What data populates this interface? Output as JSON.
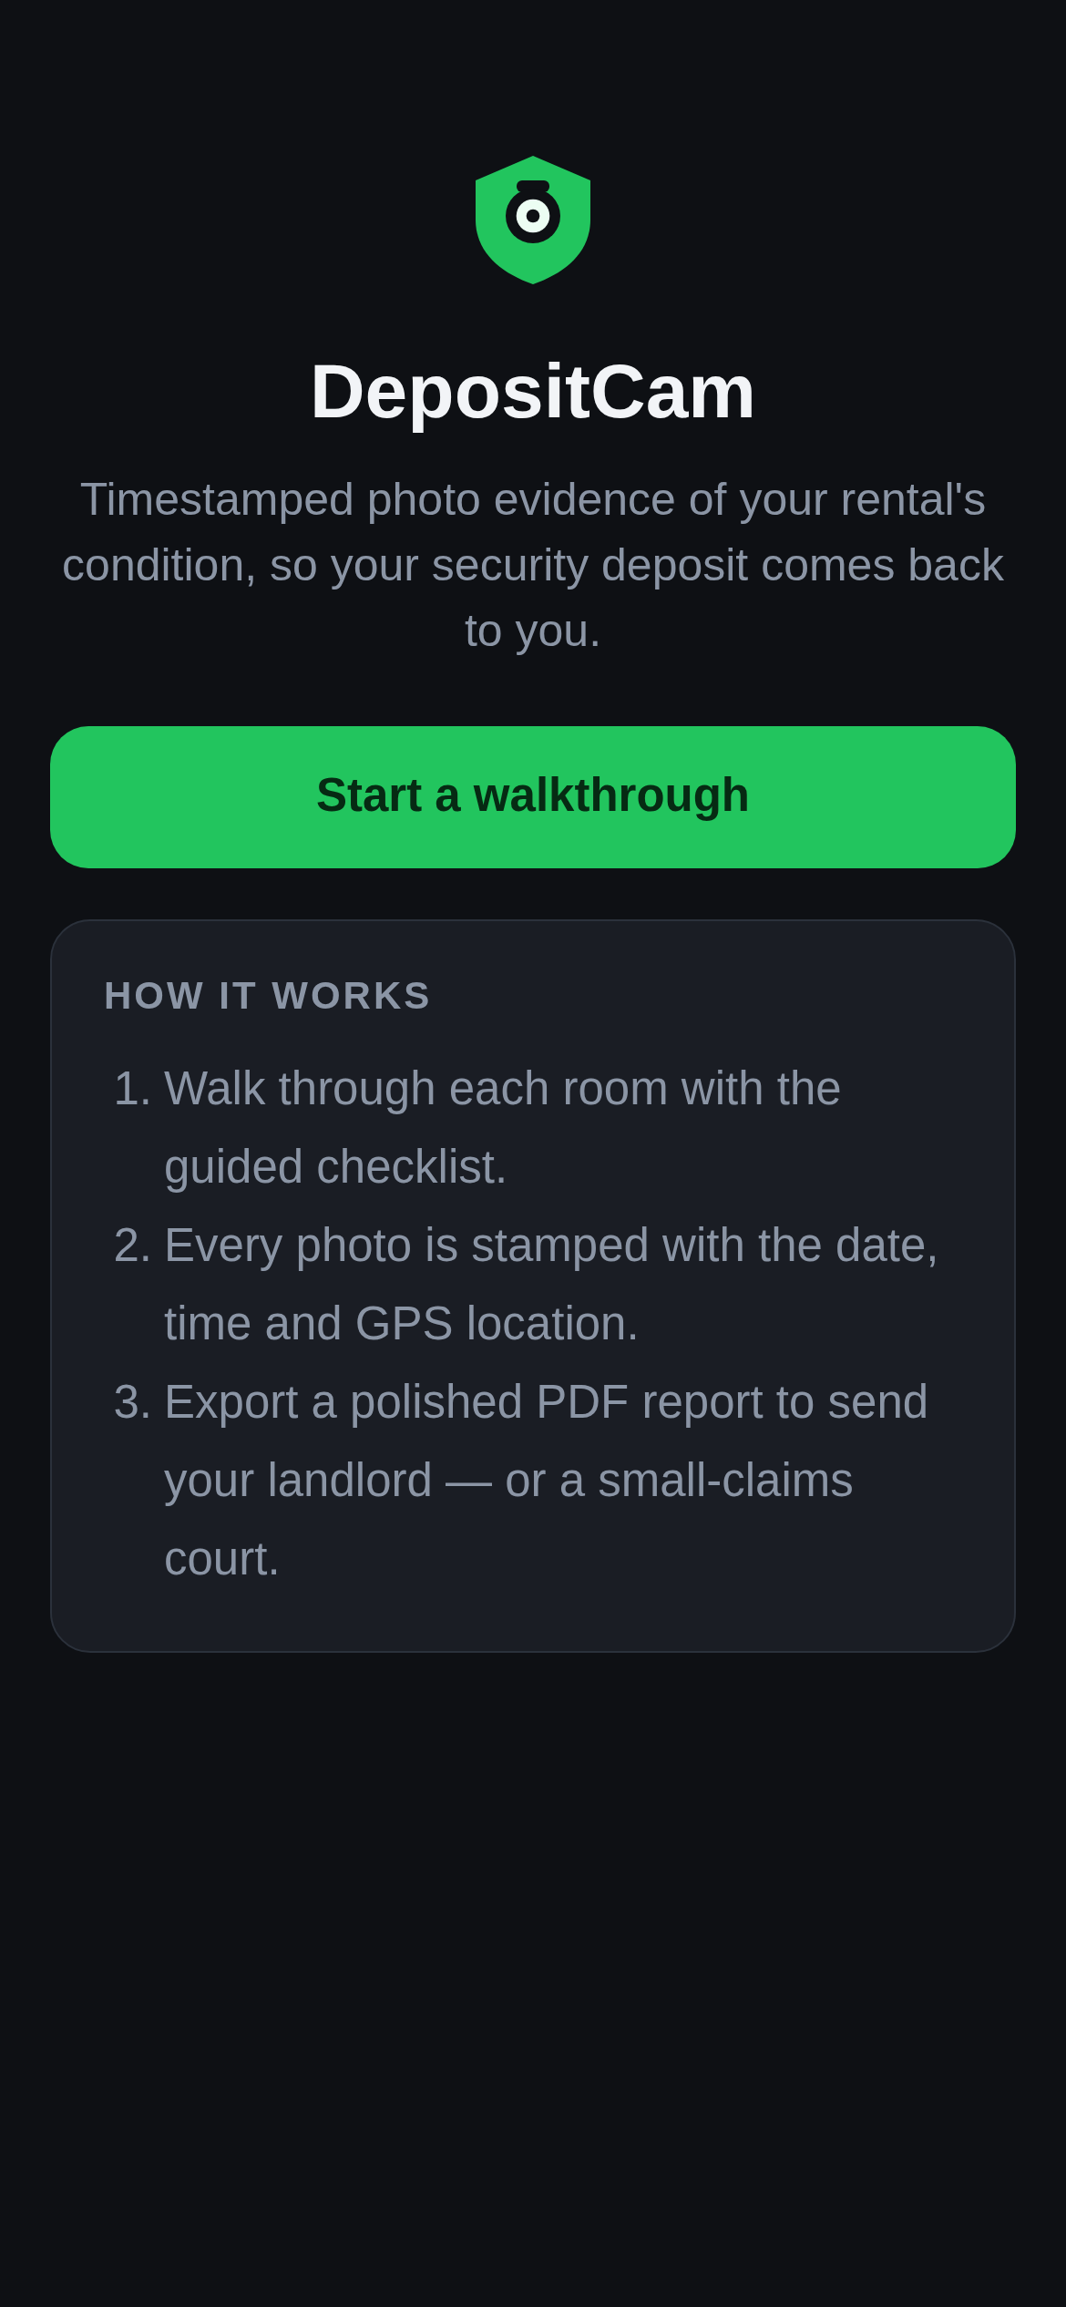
{
  "app": {
    "name": "DepositCam",
    "tagline": "Timestamped photo evidence of your rental's condition, so your security deposit comes back to you."
  },
  "primary_button": {
    "label": "Start a walkthrough"
  },
  "how_it_works": {
    "heading": "HOW IT WORKS",
    "steps": [
      {
        "number": "1.",
        "text": "Walk through each room with the guided checklist."
      },
      {
        "number": "2.",
        "text": "Every photo is stamped with the date, time and GPS location."
      },
      {
        "number": "3.",
        "text": "Export a polished PDF report to send your landlord — or a small-claims court."
      }
    ]
  }
}
